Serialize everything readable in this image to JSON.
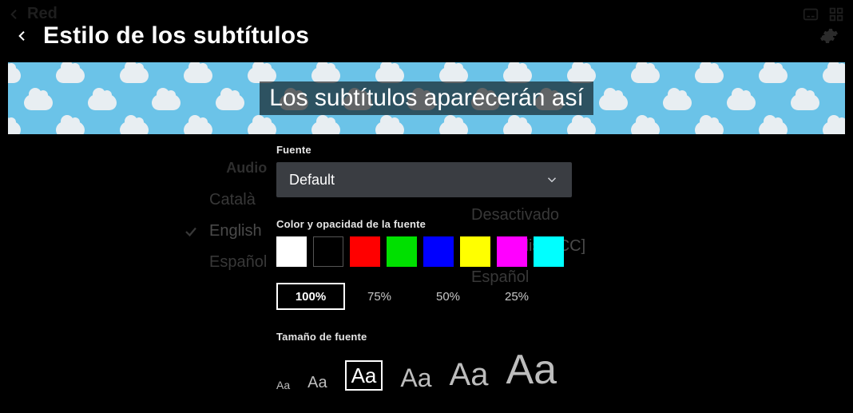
{
  "ghost": {
    "title": "Red"
  },
  "header": {
    "title": "Estilo de los subtítulos"
  },
  "preview": {
    "sample_text": "Los subtítulos aparecerán así"
  },
  "under": {
    "audio_label": "Audio",
    "audio_items": [
      "Català",
      "English",
      "Español"
    ],
    "audio_selected": 1,
    "sub_items": [
      "Desactivado",
      "English [CC]",
      "Español"
    ],
    "sub_selected": 1
  },
  "font": {
    "section_label": "Fuente",
    "dropdown_value": "Default"
  },
  "color": {
    "section_label": "Color y opacidad de la fuente",
    "swatches": [
      "#ffffff",
      "#000000",
      "#ff0000",
      "#00e000",
      "#0000ff",
      "#ffff00",
      "#ff00ff",
      "#00ffff"
    ],
    "selected_index": 0,
    "opacity_options": [
      "100%",
      "75%",
      "50%",
      "25%"
    ],
    "opacity_selected": 0
  },
  "size": {
    "section_label": "Tamaño de fuente",
    "glyph": "Aa",
    "selected_index": 2
  }
}
